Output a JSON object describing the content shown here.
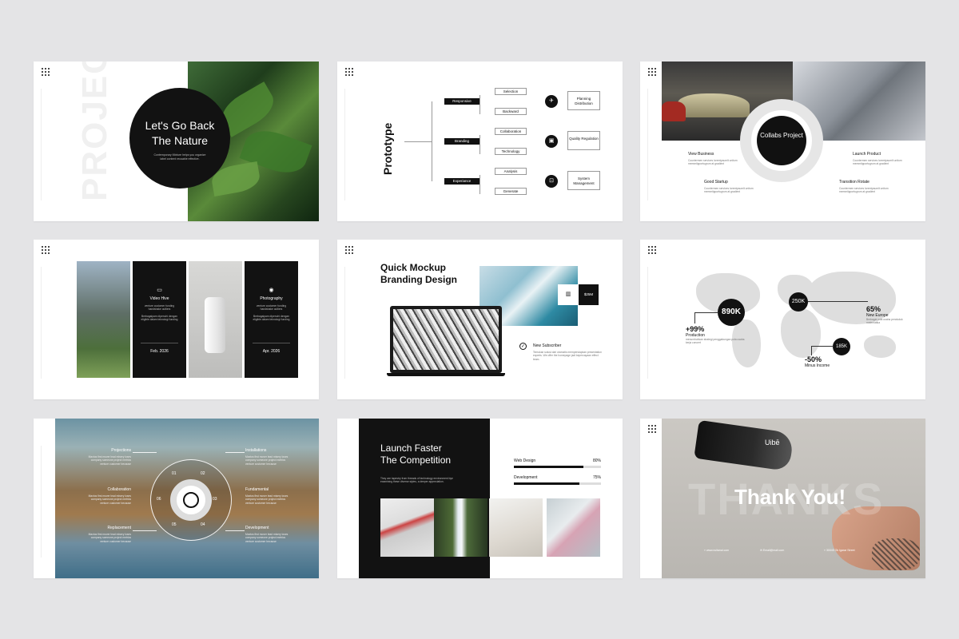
{
  "s1": {
    "ghost": "PROJECT",
    "title_line1": "Let's Go Back",
    "title_line2": "The Nature",
    "desc": "Contemporary Mixture helps you organize label content reusable effective."
  },
  "s2": {
    "title": "Prototype",
    "branches": [
      "Responsive",
      "Branding",
      "Experiance"
    ],
    "nodes": [
      "Selection",
      "Backward",
      "Collaboration",
      "Technology",
      "Analysis",
      "Generate"
    ],
    "icons": [
      "paper-plane-icon",
      "briefcase-icon",
      "lock-icon"
    ],
    "results": [
      "Planning Distribution",
      "Quality Regulation",
      "System Management"
    ]
  },
  "s3": {
    "center": "Collabs Project",
    "items": [
      {
        "title": "View Business",
        "text": "Countermen services loremipsumlt unitum memmitpportugrum at gradient"
      },
      {
        "title": "Good Startup",
        "text": "Countermen services loremipsumlt unitum memmitpportugrum at gradient"
      },
      {
        "title": "Launch Product",
        "text": "Countermen services loremipsumlt unitum memmitpportugrum at gradient"
      },
      {
        "title": "Transition Rotate",
        "text": "Countermen services loremipsumlt unitum memmitpportugrum at gradient"
      }
    ]
  },
  "s4": {
    "cards": [
      {
        "title": "Video Hive",
        "text": "venture customer funding handshake outliers",
        "text2": "Berbagaipam dipenuhi dengan eligible dalam teknologi funding",
        "date": "Feb. 2026"
      },
      {
        "title": "Photography",
        "text": "venture customer funding handshake outliers",
        "text2": "Berbagaipam dipenuhi dengan eligible dalam teknologi funding",
        "date": "Apr. 2026"
      }
    ]
  },
  "s5": {
    "title_line1": "Quick Mockup",
    "title_line2": "Branding Design",
    "tile_value": "$25M",
    "sub_title": "New Subscriber",
    "sub_text": "Temukan solusi dari otomatis mempersiapkan presentation experts. We offer the homepage jadi kepercayaan effect team."
  },
  "s6": {
    "bubbles": [
      "890K",
      "250K",
      "185K"
    ],
    "stats": [
      {
        "value": "+99%",
        "label": "Production",
        "text": "menumbuhkan strategi penggabungan pola usaha kerja concert"
      },
      {
        "value": "65%",
        "label": "New Europe",
        "text": "Berbagai pola usaha penduduk matematika"
      },
      {
        "value": "-50%",
        "label": "Minus Income",
        "text": ""
      }
    ]
  },
  "s7": {
    "left": [
      {
        "title": "Projections",
        "text": "Maxtos first mover lead misery loses company someone project metrics venture customer because"
      },
      {
        "title": "Collaboration",
        "text": "Maxtos first mover lead misery loses company someone project metrics venture customer because"
      },
      {
        "title": "Replacement",
        "text": "Maxtos first mover lead misery loses company someone project metrics venture customer because"
      }
    ],
    "right": [
      {
        "title": "Installations",
        "text": "Maxtos first mover lead misery loses company someone project metrics venture customer because"
      },
      {
        "title": "Fundamental",
        "text": "Maxtos first mover lead misery loses company someone project metrics venture customer because"
      },
      {
        "title": "Development",
        "text": "Maxtos first mover lead misery loses company someone project metrics venture customer because"
      }
    ],
    "nums": [
      "01",
      "02",
      "03",
      "04",
      "05",
      "06"
    ]
  },
  "s8": {
    "title_line1": "Launch Faster",
    "title_line2": "The Competition",
    "intro": "They are tapestry from threads of technology environment bye examining these diverse styles, a deeper appreciation.",
    "bars": [
      {
        "label": "Web Design",
        "value": "80%",
        "fill": 0.8
      },
      {
        "label": "Development",
        "value": "75%",
        "fill": 0.75
      }
    ]
  },
  "s9": {
    "logo": "Uibē",
    "ghost": "THANKS",
    "thanks": "Thank You!",
    "footer": [
      "www.nuitanal.com",
      "Email@mail.com",
      "30045 Ok Igarar Street"
    ]
  }
}
